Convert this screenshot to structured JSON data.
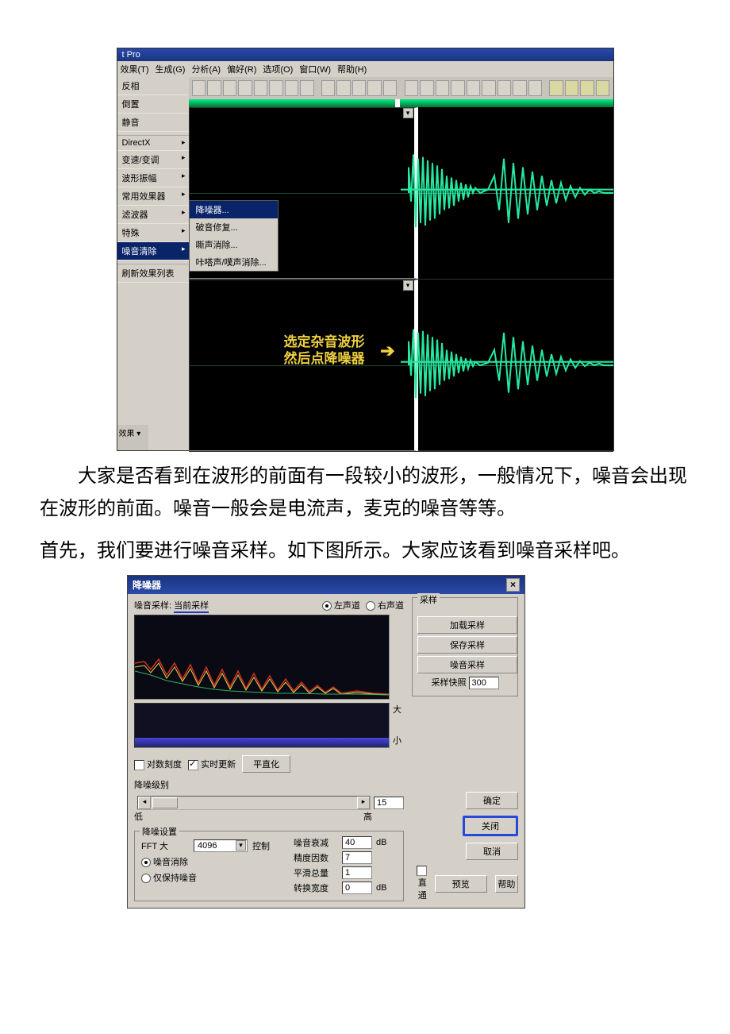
{
  "shot1": {
    "title": "t Pro",
    "menubar": [
      "效果(T)",
      "生成(G)",
      "分析(A)",
      "偏好(R)",
      "选项(O)",
      "窗口(W)",
      "帮助(H)"
    ],
    "menu_left": {
      "items": [
        {
          "label": "反相"
        },
        {
          "label": "倒置"
        },
        {
          "label": "静音"
        },
        {
          "label": "DirectX",
          "arrow": true,
          "sep_before": true
        },
        {
          "label": "变速/变调",
          "arrow": true
        },
        {
          "label": "波形振幅",
          "arrow": true
        },
        {
          "label": "常用效果器",
          "arrow": true
        },
        {
          "label": "滤波器",
          "arrow": true
        },
        {
          "label": "特殊",
          "arrow": true
        },
        {
          "label": "噪音清除",
          "arrow": true,
          "hi": true
        },
        {
          "label": "刷新效果列表",
          "sep_before": true
        }
      ]
    },
    "submenu": [
      {
        "label": "降噪器...",
        "hi": true
      },
      {
        "label": "破音修复..."
      },
      {
        "label": "嘶声消除..."
      },
      {
        "label": "咔嗒声/噗声消除..."
      }
    ],
    "annot_line1": "选定杂音波形",
    "annot_line2": "然后点降噪器",
    "bottom": "效果"
  },
  "paragraph1": "大家是否看到在波形的前面有一段较小的波形，一般情况下，噪音会出现在波形的前面。噪音一般会是电流声，麦克的噪音等等。",
  "paragraph2": "首先，我们要进行噪音采样。如下图所示。大家应该看到噪音采样吧。",
  "shot2": {
    "title": "降噪器",
    "close": "×",
    "sample_label_pre": "噪音采样:",
    "sample_label_ul": "当前采样",
    "radio_left": "左声道",
    "radio_right": "右声道",
    "group_sample": "采样",
    "btn_load": "加载采样",
    "btn_save": "保存采样",
    "btn_noise": "噪音采样",
    "snapshot_label": "采样快照",
    "snapshot_val": "300",
    "scale_big": "大",
    "scale_small": "小",
    "opt_log": "对数刻度",
    "opt_live": "实时更新",
    "btn_flatten": "平直化",
    "nr_level_label": "降噪级别",
    "slider_val": "15",
    "slider_low": "低",
    "slider_high": "高",
    "group_set": "降噪设置",
    "fft_label": "FFT 大",
    "fft_val": "4096",
    "control": "控制",
    "rd_remove": "噪音消除",
    "rd_keep": "仅保持噪音",
    "kv": [
      {
        "k": "噪音衰减",
        "v": "40",
        "u": "dB"
      },
      {
        "k": "精度因数",
        "v": "7",
        "u": ""
      },
      {
        "k": "平滑总量",
        "v": "1",
        "u": ""
      },
      {
        "k": "转换宽度",
        "v": "0",
        "u": "dB"
      }
    ],
    "btn_ok": "确定",
    "btn_close": "关闭",
    "btn_cancel": "取消",
    "btn_help": "帮助",
    "btn_preview": "预览",
    "cb_direct": "直通"
  }
}
